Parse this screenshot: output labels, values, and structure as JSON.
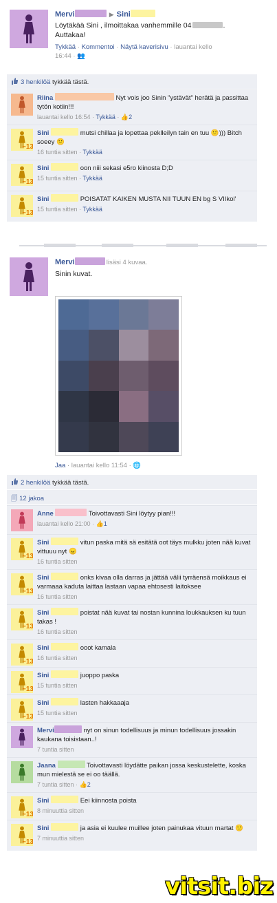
{
  "post1": {
    "author": "Mervi",
    "target": "Sini",
    "text": "Löytäkää Sini , ilmoittakaa vanhemmille 04",
    "text_tail": ".",
    "text2": "Auttakaa!",
    "actions": [
      "Tykkää",
      "Kommentoi",
      "Näytä kaverisivu"
    ],
    "time": "lauantai kello",
    "time2": "16:44",
    "likes_link": "3 henkilöä",
    "likes_tail": " tykkää tästä.",
    "comments": [
      {
        "name": "Riina",
        "avatar": "peach",
        "text": "Nyt vois joo Sinin \"ystävät\" herätä ja passittaa tytön kotiin!!!",
        "meta": "lauantai kello 16:54",
        "like": "Tykkää",
        "count": "2"
      },
      {
        "name": "Sini",
        "avatar": "yellow",
        "text": "mutsi chillaa ja lopettaa peklleilyn tain en tuu 🙂))) Bitch soeey 🙂",
        "meta": "16 tuntia sitten",
        "like": "Tykkää"
      },
      {
        "name": "Sini",
        "avatar": "yellow",
        "text": "oon niii sekasi e5ro kiinosta D;D",
        "meta": "15 tuntia sitten",
        "like": "Tykkää"
      },
      {
        "name": "Sini",
        "avatar": "yellow",
        "text": "POISATAT KAIKEN MUSTA NII TUUN EN bg S VIIkol'",
        "meta": "15 tuntia sitten",
        "like": "Tykkää"
      }
    ]
  },
  "post2": {
    "author": "Mervi",
    "action": "lisäsi 4 kuvaa.",
    "text": "Sinin kuvat.",
    "share": "Jaa",
    "time": "lauantai kello 11:54",
    "likes_link": "2 henkilöä",
    "likes_tail": " tykkää tästä.",
    "shares": "12 jakoa",
    "comments": [
      {
        "name": "Anne",
        "avatar": "pink",
        "text": "Toivottavasti Sini löytyy pian!!!",
        "meta": "lauantai kello 21:00",
        "like": "",
        "count": "1"
      },
      {
        "name": "Sini",
        "avatar": "yellow",
        "text": "vitun paska mitä sä esitätä oot täys mulkku joten nää kuvat vittuuu nyt 😠",
        "meta": "16 tuntia sitten"
      },
      {
        "name": "Sini",
        "avatar": "yellow",
        "text": "onks kivaa olla darras ja jättää välii tyrräensä moikkaus ei varmaaa kaduta laittaa lastaan vapaa ehtosesti laitokseе",
        "meta": "16 tuntia sitten"
      },
      {
        "name": "Sini",
        "avatar": "yellow",
        "text": "poistat nää kuvat tai nostan kunnina loukkauksen ku tuun takas !",
        "meta": "16 tuntia sitten"
      },
      {
        "name": "Sini",
        "avatar": "yellow",
        "text": "ooot kamala",
        "meta": "16 tuntia sitten"
      },
      {
        "name": "Sini",
        "avatar": "yellow",
        "text": "juoppo paska",
        "meta": "15 tuntia sitten"
      },
      {
        "name": "Sini",
        "avatar": "yellow",
        "text": "lasten hakkaaaja",
        "meta": "15 tuntia sitten"
      },
      {
        "name": "Mervi",
        "avatar": "purple",
        "text": "nyt on sinun todellisuus ja minun todellisuus jossakin kaukana toisistaan..!",
        "meta": "7 tuntia sitten"
      },
      {
        "name": "Jaana",
        "avatar": "green",
        "text": "Toivottavasti löydätte paikan jossa keskustelette, koska mun mielestä se ei oo täällä.",
        "meta": "7 tuntia sitten",
        "like": "",
        "count": "2"
      },
      {
        "name": "Sini",
        "avatar": "yellow",
        "text": "Eei kiinnosta poista",
        "meta": "8 minuuttia sitten"
      },
      {
        "name": "Sini",
        "avatar": "yellow",
        "text": "ja asia ei kuulee muillee joten painukaa vituun martat 🙂",
        "meta": "7 minuuttia sitten"
      }
    ]
  },
  "badge": "~13",
  "watermark": "vitsit.biz",
  "colors": {
    "link": "#3b5998",
    "feedback_bg": "#edeff4",
    "watermark": "#fff200"
  }
}
